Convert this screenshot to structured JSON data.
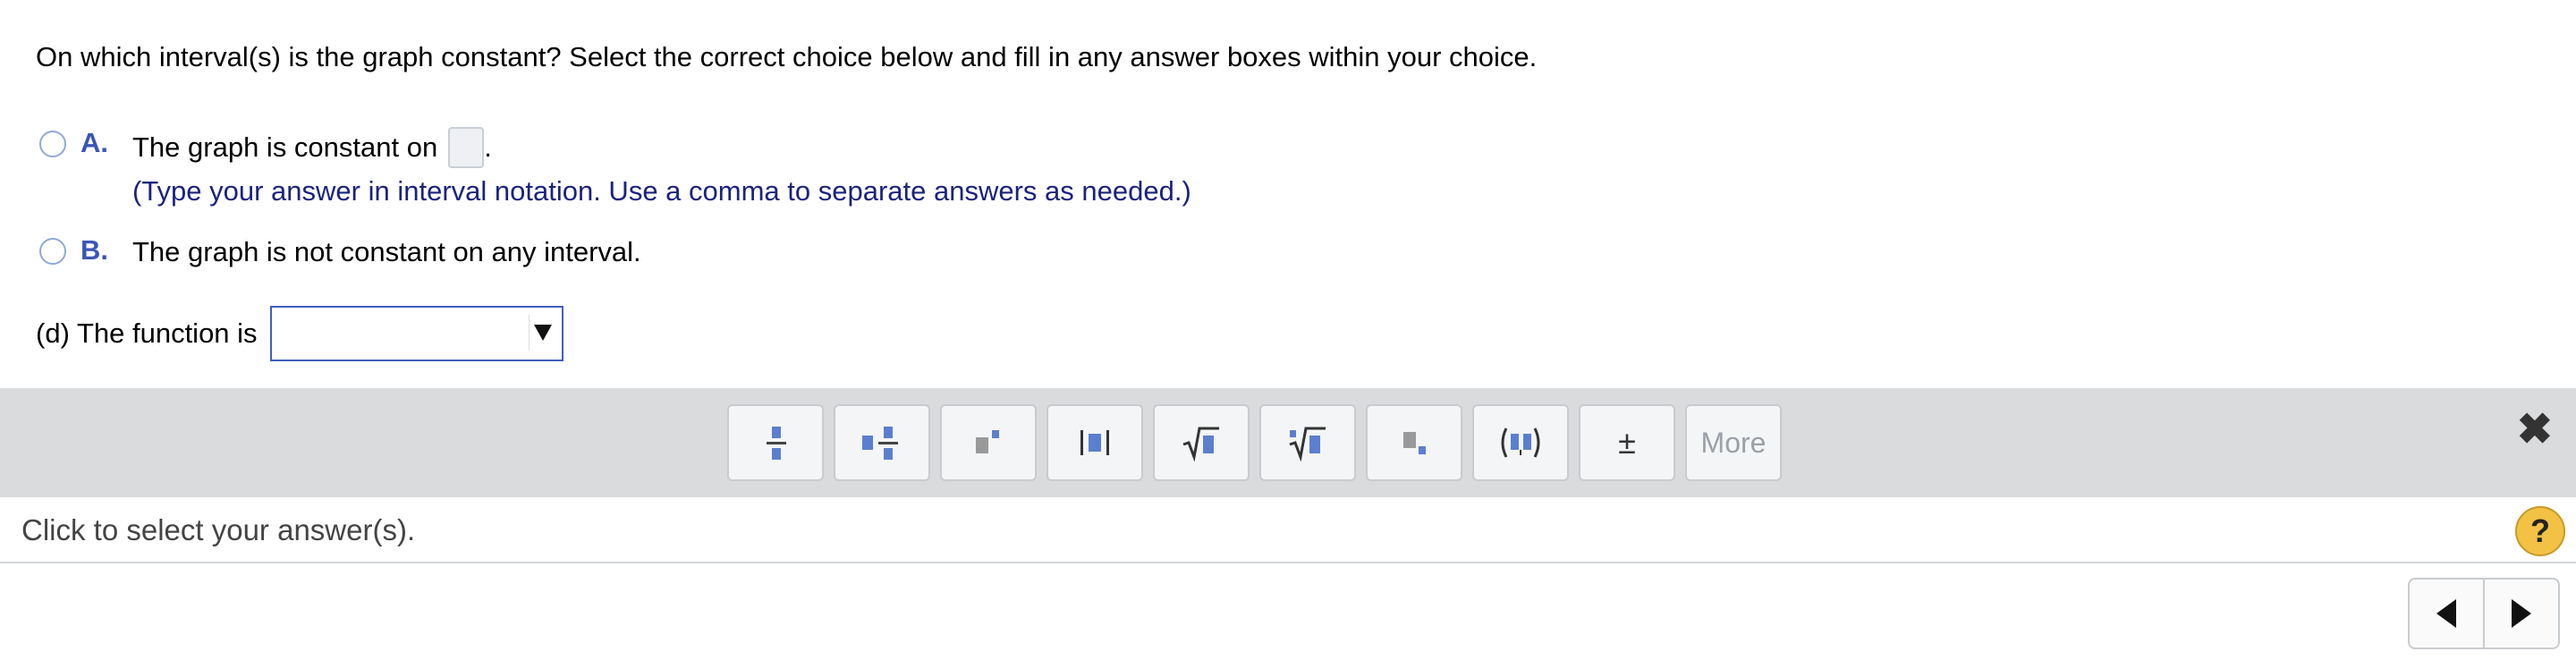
{
  "question": "On which interval(s) is the graph constant? Select the correct choice below and fill in any answer boxes within your choice.",
  "choices": [
    {
      "letter": "A.",
      "text": "The graph is constant on",
      "suffix": ".",
      "hint": "(Type your answer in interval notation. Use a comma to separate answers as needed.)"
    },
    {
      "letter": "B.",
      "text": "The graph is not constant on any interval."
    }
  ],
  "part_d": {
    "label": "(d)  The function is",
    "selected": ""
  },
  "toolbar": {
    "buttons": [
      "fraction-icon",
      "mixed-number-icon",
      "exponent-icon",
      "absolute-value-icon",
      "square-root-icon",
      "nth-root-icon",
      "subscript-icon",
      "interval-icon",
      "plus-minus-icon"
    ],
    "plus_minus": "±",
    "more_label": "More",
    "close": "✖"
  },
  "status": {
    "text": "Click to select your answer(s).",
    "help": "?"
  },
  "colors": {
    "accent": "#3a55b4",
    "hint": "#1a237e",
    "toolbar_bg": "#d9dbdd",
    "icon_blue": "#5b7fcf"
  }
}
